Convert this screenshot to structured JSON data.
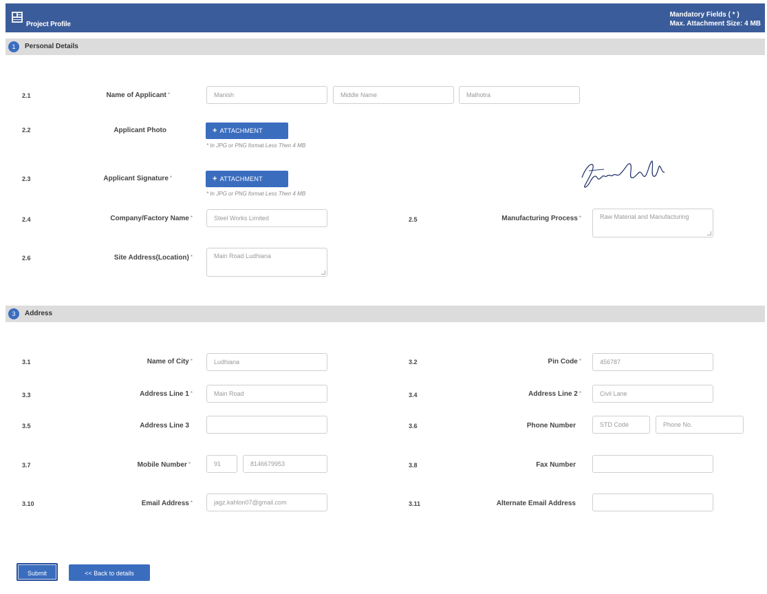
{
  "header": {
    "title": "Project Profile",
    "mandatory_note": "Mandatory Fields ( * )",
    "attachment_note": "Max. Attachment Size: 4 MB"
  },
  "sections": {
    "personal": {
      "number": "1",
      "label": "Personal Details"
    },
    "address": {
      "number": "3",
      "label": "Address"
    }
  },
  "personal": {
    "applicant_name": {
      "num": "2.1",
      "label": "Name of Applicant",
      "required": "*",
      "first": "Manish",
      "middle_placeholder": "Middle Name",
      "last": "Malhotra"
    },
    "photo": {
      "num": "2.2",
      "label": "Applicant Photo",
      "button": "ATTACHMENT",
      "hint": "* In JPG or PNG format Less Then 4 MB"
    },
    "signature": {
      "num": "2.3",
      "label": "Applicant Signature",
      "required": "*",
      "button": "ATTACHMENT",
      "hint": "* In JPG or PNG format Less Then 4 MB"
    },
    "company": {
      "num": "2.4",
      "label": "Company/Factory Name",
      "required": "*",
      "value": "Steel Works Limited"
    },
    "process": {
      "num": "2.5",
      "label": "Manufacturing Process",
      "required": "*",
      "value": "Raw Material and Manufacturing"
    },
    "site": {
      "num": "2.6",
      "label": "Site Address(Location)",
      "required": "*",
      "value": "Main Road Ludhiana"
    }
  },
  "address": {
    "city": {
      "num": "3.1",
      "label": "Name of City",
      "required": "*",
      "value": "Ludhiana"
    },
    "pin": {
      "num": "3.2",
      "label": "Pin Code",
      "required": "*",
      "value": "456787"
    },
    "line1": {
      "num": "3.3",
      "label": "Address Line 1",
      "required": "*",
      "value": "Main Road"
    },
    "line2": {
      "num": "3.4",
      "label": "Address Line 2",
      "required": "*",
      "value": "Civil Lane"
    },
    "line3": {
      "num": "3.5",
      "label": "Address Line 3",
      "value": ""
    },
    "phone": {
      "num": "3.6",
      "label": "Phone Number",
      "std_placeholder": "STD Code",
      "phone_placeholder": "Phone No."
    },
    "mobile": {
      "num": "3.7",
      "label": "Mobile Number",
      "required": "*",
      "code": "91",
      "value": "8146679953"
    },
    "fax": {
      "num": "3.8",
      "label": "Fax Number",
      "value": ""
    },
    "email": {
      "num": "3.10",
      "label": "Email Address",
      "required": "*",
      "value": "jagz.kahlon07@gmail.com"
    },
    "alt_email": {
      "num": "3.11",
      "label": "Alternate Email Address",
      "value": ""
    }
  },
  "actions": {
    "submit": "Submit",
    "back": "<< Back to details"
  },
  "colors": {
    "header_bg": "#3b5c9a",
    "button_bg": "#3b6dbf",
    "section_bg": "#dcdcdc"
  }
}
